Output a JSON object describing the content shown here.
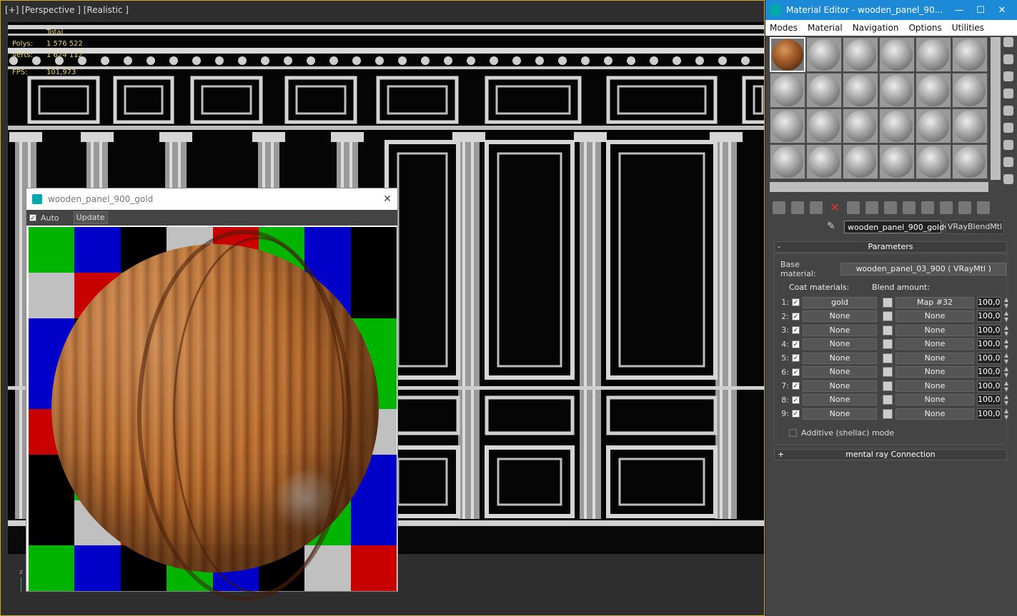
{
  "viewport": {
    "label": "[+] [Perspective ] [Realistic ]",
    "stats": [
      {
        "label": "",
        "value": "Total"
      },
      {
        "label": "Polys:",
        "value": "1 576 522"
      },
      {
        "label": "Verts:",
        "value": "1 624 112"
      },
      {
        "label": "FPS:",
        "value": "101,973"
      }
    ],
    "axis": "z"
  },
  "material_editor": {
    "title": "Material Editor - wooden_panel_90...",
    "menu": [
      "Modes",
      "Material",
      "Navigation",
      "Options",
      "Utilities"
    ],
    "material_name": "wooden_panel_900_gold",
    "material_type": "VRayBlendMtl",
    "parameters_label": "Parameters",
    "base_material_label": "Base material:",
    "base_material_value": "wooden_panel_03_900  ( VRayMtl )",
    "coat_header": "Coat materials:",
    "blend_header": "Blend amount:",
    "coats": [
      {
        "n": "1:",
        "coat": "gold",
        "map": "Map #32",
        "amount": "100,0"
      },
      {
        "n": "2:",
        "coat": "None",
        "map": "None",
        "amount": "100,0"
      },
      {
        "n": "3:",
        "coat": "None",
        "map": "None",
        "amount": "100,0"
      },
      {
        "n": "4:",
        "coat": "None",
        "map": "None",
        "amount": "100,0"
      },
      {
        "n": "5:",
        "coat": "None",
        "map": "None",
        "amount": "100,0"
      },
      {
        "n": "6:",
        "coat": "None",
        "map": "None",
        "amount": "100,0"
      },
      {
        "n": "7:",
        "coat": "None",
        "map": "None",
        "amount": "100,0"
      },
      {
        "n": "8:",
        "coat": "None",
        "map": "None",
        "amount": "100,0"
      },
      {
        "n": "9:",
        "coat": "None",
        "map": "None",
        "amount": "100,0"
      }
    ],
    "shellac_label": "Additive (shellac) mode",
    "mental_ray_label": "mental ray Connection"
  },
  "preview": {
    "title": "wooden_panel_900_gold",
    "auto_label": "Auto",
    "update_label": "Update",
    "checker_colors": [
      "#00b400",
      "#0000c8",
      "#000000",
      "#c0c0c0",
      "#c80000",
      "#00b400",
      "#0000c8",
      "#000000"
    ]
  }
}
